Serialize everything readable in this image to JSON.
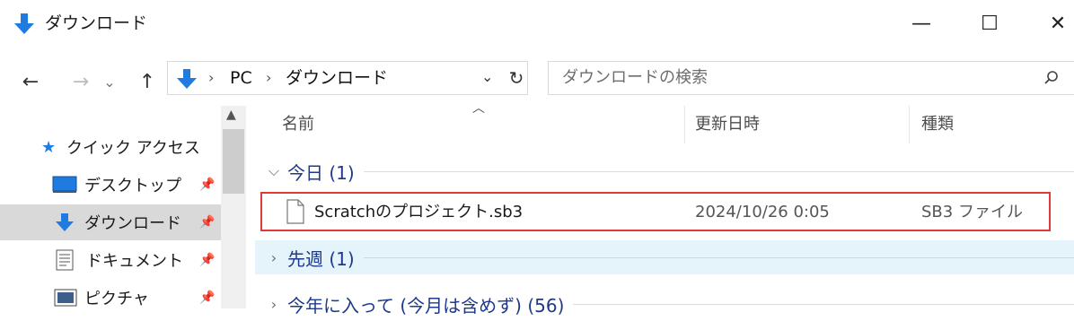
{
  "window": {
    "title": "ダウンロード",
    "controls": {
      "minimize": "—",
      "maximize": "☐",
      "close": "✕"
    }
  },
  "nav": {
    "back": "←",
    "forward": "→",
    "recent": "⌄",
    "up": "↑",
    "breadcrumbs": [
      "PC",
      "ダウンロード"
    ],
    "dropdown": "⌄",
    "refresh": "↻",
    "search_placeholder": "ダウンロードの検索"
  },
  "sidebar": {
    "items": [
      {
        "label": "クイック アクセス",
        "icon": "star-icon",
        "pinned": false,
        "selected": false
      },
      {
        "label": "デスクトップ",
        "icon": "desktop-icon",
        "pinned": true,
        "selected": false
      },
      {
        "label": "ダウンロード",
        "icon": "download-icon",
        "pinned": true,
        "selected": true
      },
      {
        "label": "ドキュメント",
        "icon": "document-icon",
        "pinned": true,
        "selected": false
      },
      {
        "label": "ピクチャ",
        "icon": "picture-icon",
        "pinned": true,
        "selected": false
      }
    ]
  },
  "list": {
    "columns": {
      "name": "名前",
      "modified": "更新日時",
      "type": "種類"
    },
    "groups": [
      {
        "label": "今日 (1)",
        "expanded": true
      },
      {
        "label": "先週 (1)",
        "expanded": false
      },
      {
        "label": "今年に入って (今月は含めず) (56)",
        "expanded": false
      }
    ],
    "files": [
      {
        "name": "Scratchのプロジェクト.sb3",
        "modified": "2024/10/26 0:05",
        "type": "SB3 ファイル"
      }
    ]
  },
  "colors": {
    "accent": "#0078d7",
    "highlight_border": "#e03a3a",
    "group_text": "#1e3a8a"
  }
}
